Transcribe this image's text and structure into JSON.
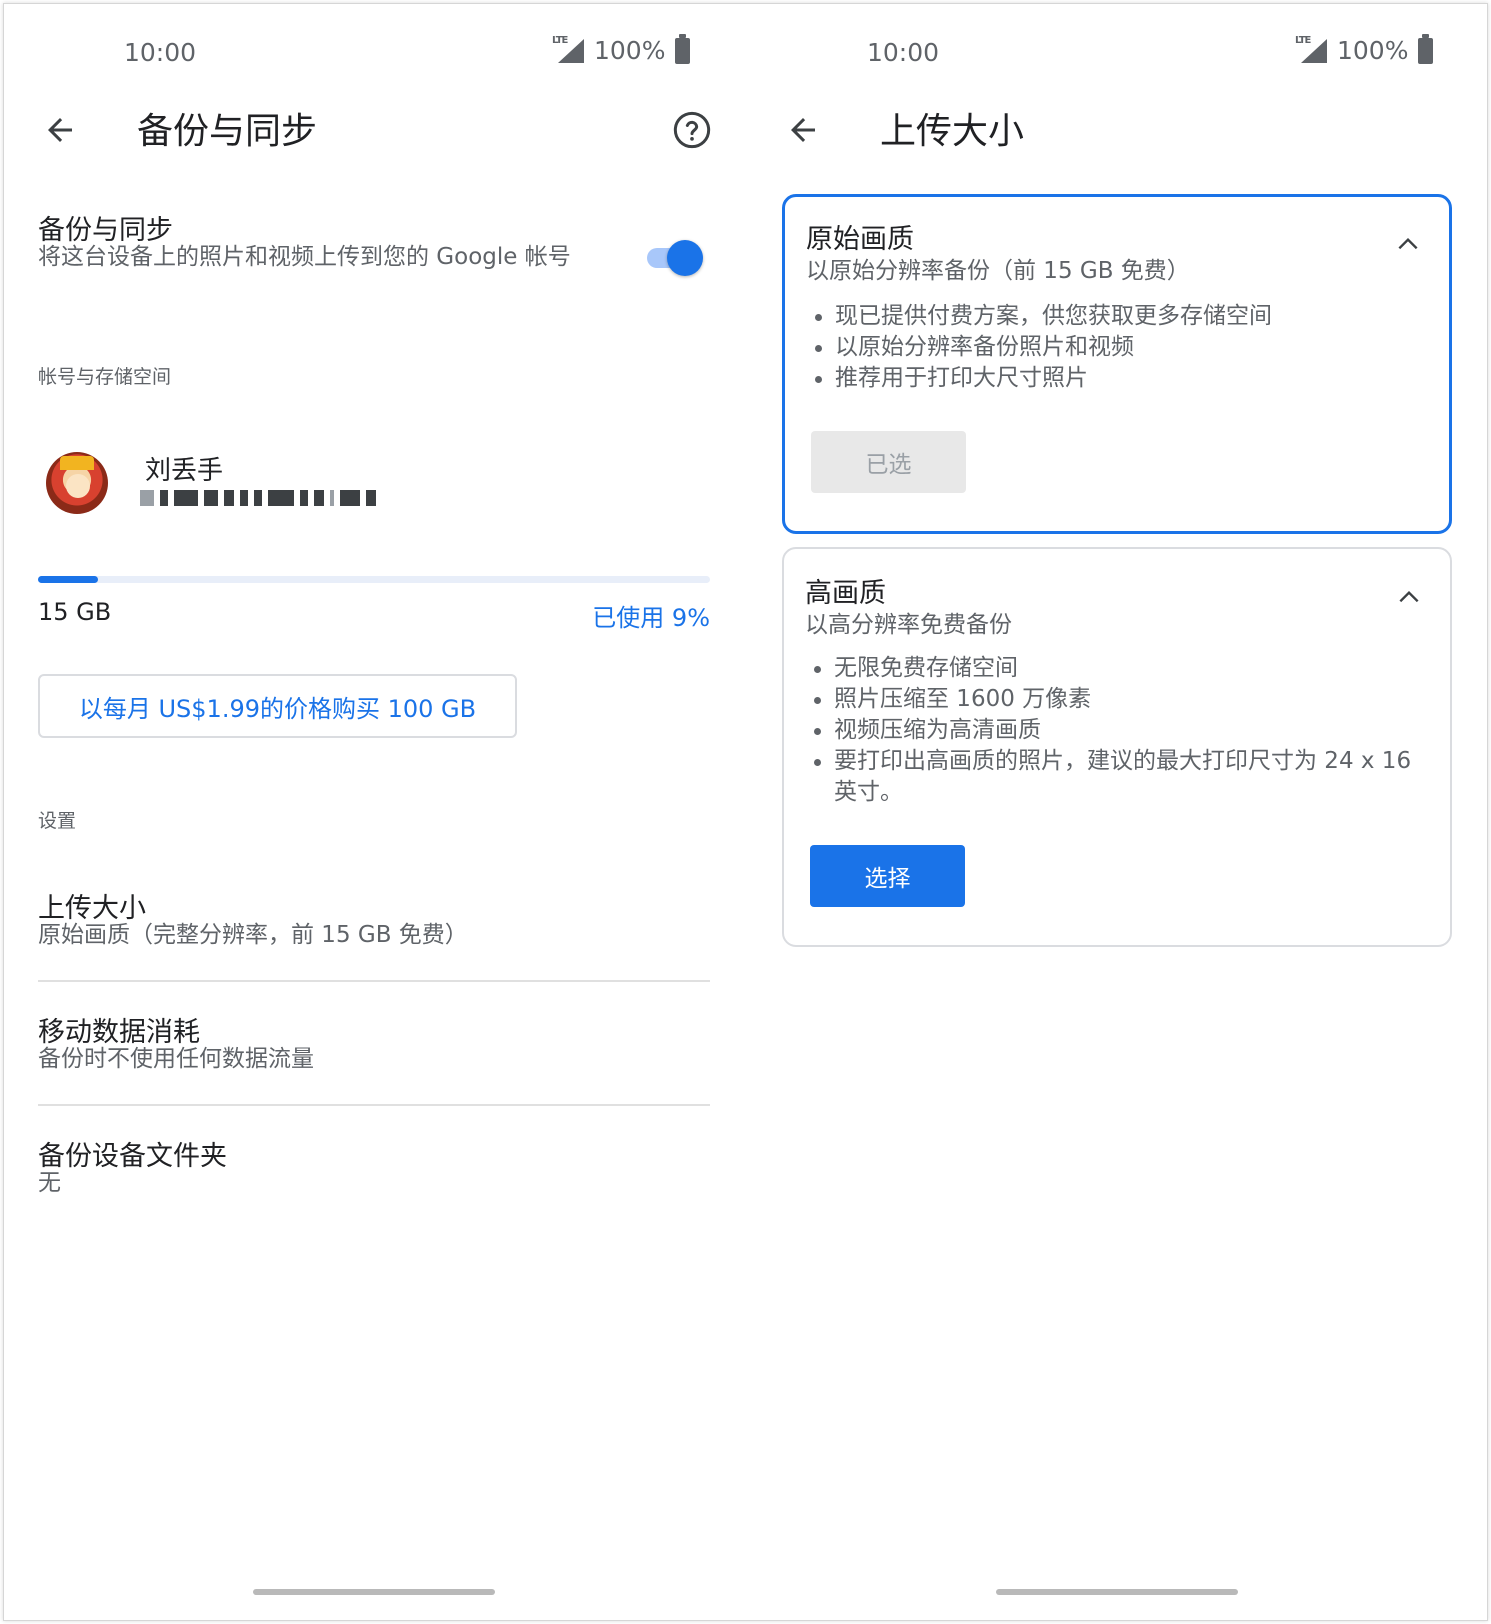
{
  "left": {
    "status": {
      "time": "10:00",
      "network": "LTE",
      "battery": "100%"
    },
    "title": "备份与同步",
    "backup_toggle": {
      "title": "备份与同步",
      "description": "将这台设备上的照片和视频上传到您的 Google 帐号",
      "enabled": true
    },
    "account_section_label": "帐号与存储空间",
    "account": {
      "name": "刘丢手"
    },
    "storage": {
      "total": "15 GB",
      "used_label": "已使用 9%",
      "used_fraction": 0.09
    },
    "buy_button": "以每月 US$1.99的价格购买 100 GB",
    "settings_label": "设置",
    "settings": [
      {
        "title": "上传大小",
        "subtitle": "原始画质（完整分辨率，前 15 GB 免费）"
      },
      {
        "title": "移动数据消耗",
        "subtitle": "备份时不使用任何数据流量"
      },
      {
        "title": "备份设备文件夹",
        "subtitle": "无"
      }
    ]
  },
  "right": {
    "status": {
      "time": "10:00",
      "network": "LTE",
      "battery": "100%"
    },
    "title": "上传大小",
    "options": [
      {
        "title": "原始画质",
        "subtitle": "以原始分辨率备份（前 15 GB 免费）",
        "bullets": [
          "现已提供付费方案，供您获取更多存储空间",
          "以原始分辨率备份照片和视频",
          "推荐用于打印大尺寸照片"
        ],
        "button": "已选",
        "selected": true
      },
      {
        "title": "高画质",
        "subtitle": "以高分辨率免费备份",
        "bullets": [
          "无限免费存储空间",
          "照片压缩至 1600 万像素",
          "视频压缩为高清画质",
          "要打印出高画质的照片，建议的最大打印尺寸为 24 x 16 英寸。"
        ],
        "button": "选择",
        "selected": false
      }
    ]
  },
  "colors": {
    "accent": "#1a73e8",
    "text_primary": "#202124",
    "text_secondary": "#5f6368",
    "divider": "#e0e0e0"
  }
}
